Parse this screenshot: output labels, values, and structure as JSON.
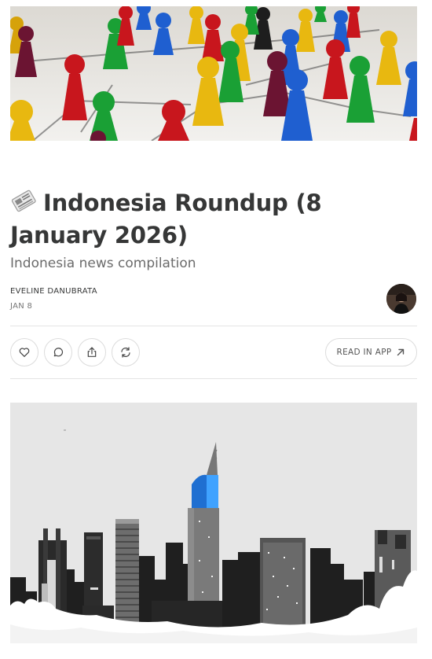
{
  "post": {
    "title": "Indonesia Roundup (8 January 2026)",
    "title_emoji": "newspaper-icon",
    "subtitle": "Indonesia news compilation",
    "author": "EVELINE DANUBRATA",
    "date": "JAN 8"
  },
  "actions": {
    "like_icon": "heart-icon",
    "comment_icon": "comment-icon",
    "share_icon": "share-icon",
    "restack_icon": "restack-icon",
    "read_in_app_label": "READ IN APP",
    "read_in_app_icon": "arrow-up-right-icon"
  },
  "images": {
    "hero": "game-pieces-network-image",
    "body": "jakarta-skyline-illustration"
  },
  "colors": {
    "text": "#363737",
    "muted": "#6b6b6b",
    "border": "#dcdcdc",
    "tower_blue": "#2f8ff0"
  }
}
